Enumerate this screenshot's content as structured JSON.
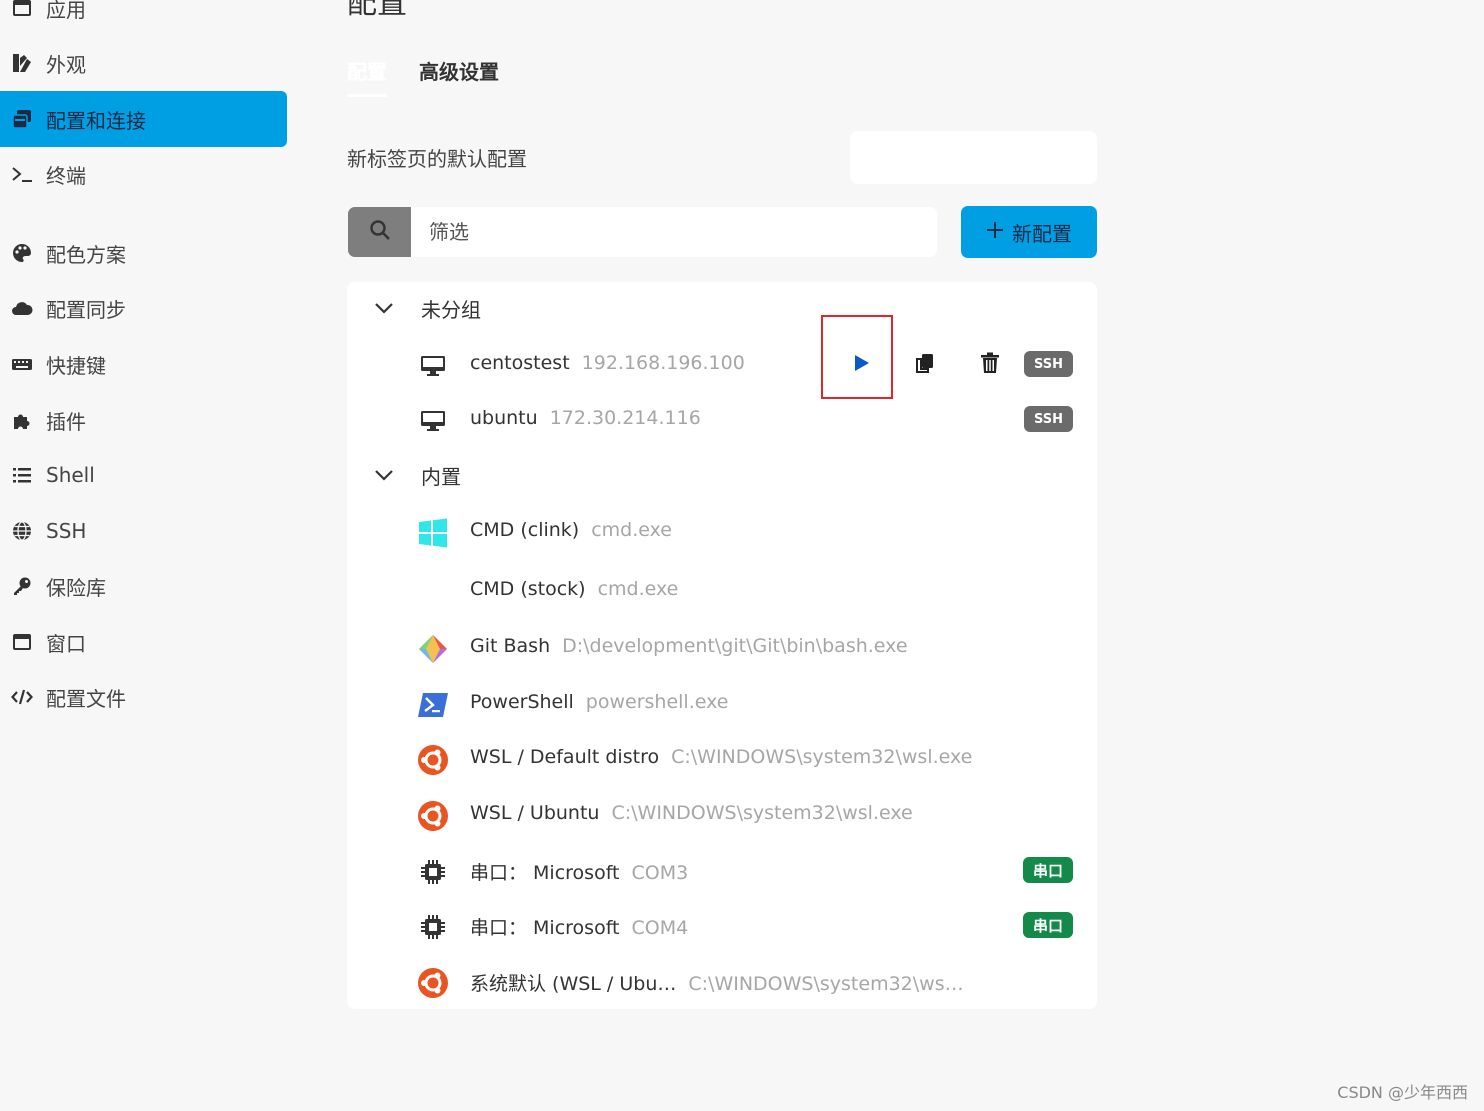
{
  "sidebar": {
    "items": [
      {
        "label": "应用",
        "icon": "window-icon"
      },
      {
        "label": "外观",
        "icon": "appearance-icon"
      },
      {
        "label": "配置和连接",
        "icon": "profiles-icon",
        "active": true
      },
      {
        "label": "终端",
        "icon": "terminal-icon"
      },
      {
        "label": "配色方案",
        "icon": "palette-icon"
      },
      {
        "label": "配置同步",
        "icon": "cloud-icon"
      },
      {
        "label": "快捷键",
        "icon": "keyboard-icon"
      },
      {
        "label": "插件",
        "icon": "puzzle-icon"
      },
      {
        "label": "Shell",
        "icon": "list-icon"
      },
      {
        "label": "SSH",
        "icon": "globe-icon"
      },
      {
        "label": "保险库",
        "icon": "key-icon"
      },
      {
        "label": "窗口",
        "icon": "window-icon"
      },
      {
        "label": "配置文件",
        "icon": "code-icon"
      }
    ]
  },
  "main": {
    "title": "配置",
    "tabs": [
      {
        "label": "配置",
        "active": true
      },
      {
        "label": "高级设置"
      }
    ],
    "default_profile_label": "新标签页的默认配置",
    "default_profile_value": "",
    "filter_placeholder": "筛选",
    "new_profile_label": "新配置"
  },
  "groups": [
    {
      "title": "未分组",
      "profiles": [
        {
          "name": "centostest",
          "desc": "192.168.196.100",
          "icon": "monitor-icon",
          "badge": "SSH"
        },
        {
          "name": "ubuntu",
          "desc": "172.30.214.116",
          "icon": "monitor-icon",
          "badge": "SSH"
        }
      ]
    },
    {
      "title": "内置",
      "profiles": [
        {
          "name": "CMD (clink)",
          "desc": "cmd.exe",
          "icon": "windows-icon",
          "badge": ""
        },
        {
          "name": "CMD (stock)",
          "desc": "cmd.exe",
          "icon": "",
          "badge": ""
        },
        {
          "name": "Git Bash",
          "desc": "D:\\development\\git\\Git\\bin\\bash.exe",
          "icon": "git-icon",
          "badge": ""
        },
        {
          "name": "PowerShell",
          "desc": "powershell.exe",
          "icon": "powershell-icon",
          "badge": ""
        },
        {
          "name": "WSL / Default distro",
          "desc": "C:\\WINDOWS\\system32\\wsl.exe",
          "icon": "ubuntu-icon",
          "badge": ""
        },
        {
          "name": "WSL / Ubuntu",
          "desc": "C:\\WINDOWS\\system32\\wsl.exe",
          "icon": "ubuntu-icon",
          "badge": ""
        },
        {
          "name": "串口： Microsoft",
          "desc": "COM3",
          "icon": "chip-icon",
          "badge": "串口"
        },
        {
          "name": "串口： Microsoft",
          "desc": "COM4",
          "icon": "chip-icon",
          "badge": "串口"
        },
        {
          "name": "系统默认 (WSL / Ubu…",
          "desc": "C:\\WINDOWS\\system32\\ws…",
          "icon": "ubuntu-icon",
          "badge": ""
        }
      ]
    }
  ],
  "colors": {
    "accent": "#009fe3",
    "ssh_badge": "#6b6b6b",
    "serial_badge": "#138a4a",
    "highlight_box": "#e0262b"
  },
  "watermark": "CSDN @少年西西"
}
